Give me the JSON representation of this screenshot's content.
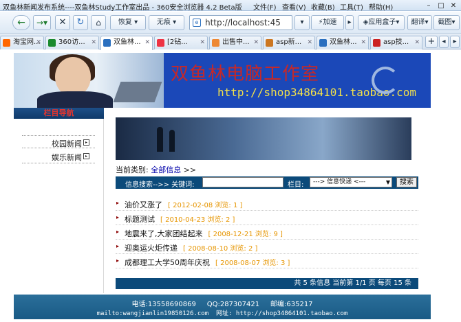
{
  "window": {
    "title": "双鱼林新闻发布系统----双鱼林Study工作室出品 - 360安全浏览器 4.2 Beta版",
    "menus": [
      "文件(F)",
      "查看(V)",
      "收藏(B)",
      "工具(T)",
      "帮助(H)"
    ]
  },
  "toolbar": {
    "restore": "恢复",
    "no_image": "无痕",
    "address": "http://localhost:45",
    "accelerate": "加速",
    "app_box": "应用盒子",
    "translate": "翻译",
    "screenshot": "截图"
  },
  "tabs": [
    {
      "label": "淘宝网..."
    },
    {
      "label": "360访..."
    },
    {
      "label": "双鱼林..."
    },
    {
      "label": "[2钻..."
    },
    {
      "label": "出售中..."
    },
    {
      "label": "asp新..."
    },
    {
      "label": "双鱼林..."
    },
    {
      "label": "asp技..."
    }
  ],
  "banner": {
    "title": "双鱼林电脑工作室",
    "url": "http://shop34864101.taobao.com"
  },
  "sidebar": {
    "header": "栏目导航",
    "items": [
      "校园新闻",
      "娱乐新闻"
    ]
  },
  "breadcrumb": {
    "prefix": "当前类别:",
    "link": "全部信息",
    "suffix": ">>"
  },
  "search": {
    "label": "信息搜索-->> 关键词:",
    "keyword": "",
    "column_label": "栏目:",
    "column_value": "---> 信息快递 <---",
    "button": "搜索"
  },
  "news": [
    {
      "title": "油价又涨了",
      "date": "2012-02-08",
      "views_label": "浏览:",
      "views": "1"
    },
    {
      "title": "标题测试",
      "date": "2010-04-23",
      "views_label": "浏览:",
      "views": "2"
    },
    {
      "title": "地震来了,大家团结起来",
      "date": "2008-12-21",
      "views_label": "浏览:",
      "views": "9"
    },
    {
      "title": "迎奥运火炬传递",
      "date": "2008-08-10",
      "views_label": "浏览:",
      "views": "2"
    },
    {
      "title": "成都理工大学50周年庆祝",
      "date": "2008-08-07",
      "views_label": "浏览:",
      "views": "3"
    }
  ],
  "pager": {
    "text": "共 5 条信息 当前第 1/1 页 每页 15 条"
  },
  "footer": {
    "phone": "电话:13558690869",
    "qq": "QQ:287307421",
    "zip": "邮编:635217",
    "mail": "mailto:wangjianlin19850126.com",
    "site": "网址: http://shop34864101.taobao.com"
  }
}
